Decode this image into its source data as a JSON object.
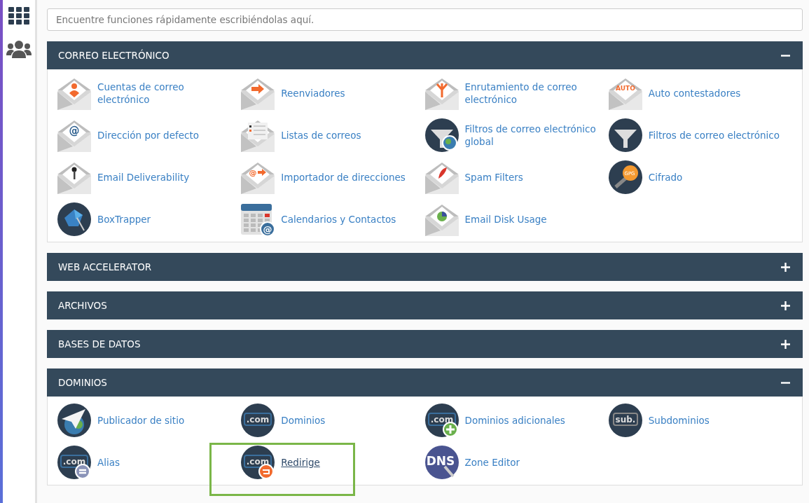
{
  "search": {
    "placeholder": "Encuentre funciones rápidamente escribiéndolas aquí."
  },
  "sections": [
    {
      "title": "CORREO ELECTRÓNICO",
      "expanded": true,
      "items": [
        {
          "label": "Cuentas de correo electrónico",
          "highlighted": false
        },
        {
          "label": "Reenviadores",
          "highlighted": false
        },
        {
          "label": "Enrutamiento de correo electrónico",
          "highlighted": false
        },
        {
          "label": "Auto contestadores",
          "icon_text": "AUTO",
          "highlighted": false
        },
        {
          "label": "Dirección por defecto",
          "icon_text": "@",
          "highlighted": false
        },
        {
          "label": "Listas de correos",
          "highlighted": false
        },
        {
          "label": "Filtros de correo electrónico global",
          "highlighted": false
        },
        {
          "label": "Filtros de correo electrónico",
          "highlighted": false
        },
        {
          "label": "Email Deliverability",
          "highlighted": false
        },
        {
          "label": "Importador de direcciones",
          "icon_text": "@",
          "highlighted": false
        },
        {
          "label": "Spam Filters",
          "highlighted": false
        },
        {
          "label": "Cifrado",
          "icon_text": "GPG",
          "highlighted": false
        },
        {
          "label": "BoxTrapper",
          "highlighted": false
        },
        {
          "label": "Calendarios y Contactos",
          "icon_text": "@",
          "highlighted": false
        },
        {
          "label": "Email Disk Usage",
          "highlighted": false
        }
      ]
    },
    {
      "title": "WEB ACCELERATOR",
      "expanded": false
    },
    {
      "title": "ARCHIVOS",
      "expanded": false
    },
    {
      "title": "BASES DE DATOS",
      "expanded": false
    },
    {
      "title": "DOMINIOS",
      "expanded": true,
      "items": [
        {
          "label": "Publicador de sitio",
          "highlighted": false
        },
        {
          "label": "Dominios",
          "icon_text": ".com",
          "highlighted": false
        },
        {
          "label": "Dominios adicionales",
          "icon_text": ".com",
          "highlighted": false
        },
        {
          "label": "Subdominios",
          "icon_text": "sub.",
          "highlighted": false
        },
        {
          "label": "Alias",
          "icon_text": ".com",
          "highlighted": false
        },
        {
          "label": "Redirige",
          "icon_text": ".com",
          "highlighted": true
        },
        {
          "label": "Zone Editor",
          "icon_text": "DNS",
          "highlighted": false
        }
      ]
    }
  ]
}
